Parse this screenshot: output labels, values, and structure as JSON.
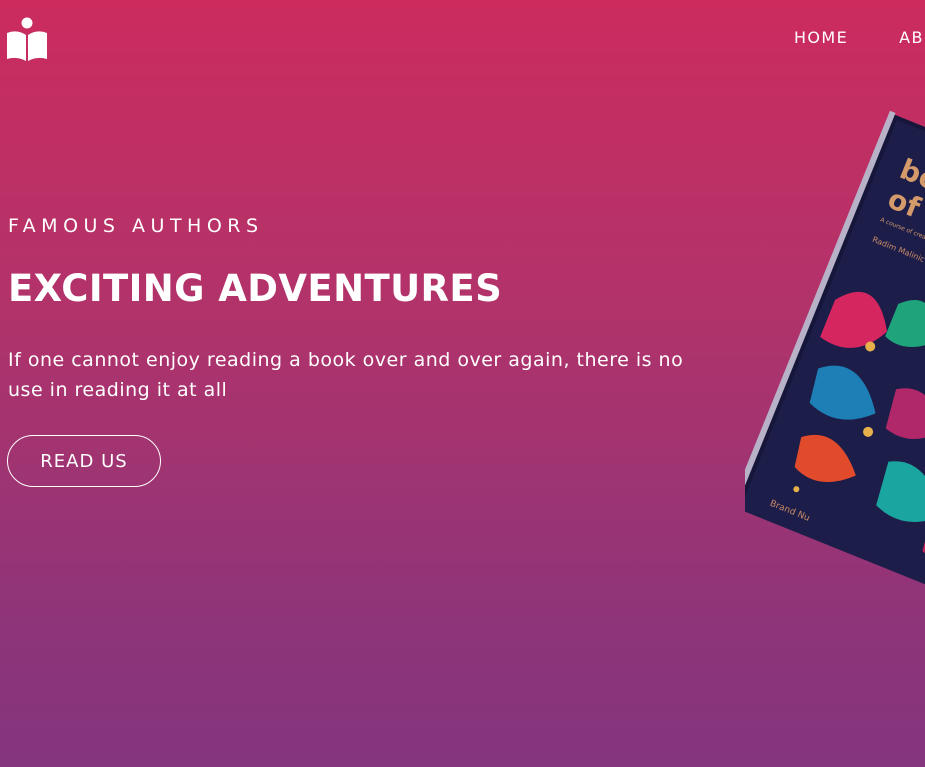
{
  "header": {
    "logo_icon": "open-book-reader-icon",
    "nav": [
      {
        "label": "HOME"
      },
      {
        "label": "AB"
      }
    ]
  },
  "hero": {
    "kicker": "FAMOUS AUTHORS",
    "headline": "EXCITING ADVENTURES",
    "lead": "If one cannot enjoy reading a book over and over again, there is no use in reading it at all",
    "cta_label": "READ US",
    "book": {
      "title_line1": "book",
      "title_line2": "of ide",
      "subtitle": "A course of creative direction and graphic design",
      "author": "Radim Malinic",
      "publisher": "Brand Nu"
    }
  },
  "colors": {
    "gradient_top": "#cc2b5e",
    "gradient_bottom": "#84357e",
    "book_cover": "#1d1d4a",
    "book_title": "#d49a6a"
  }
}
